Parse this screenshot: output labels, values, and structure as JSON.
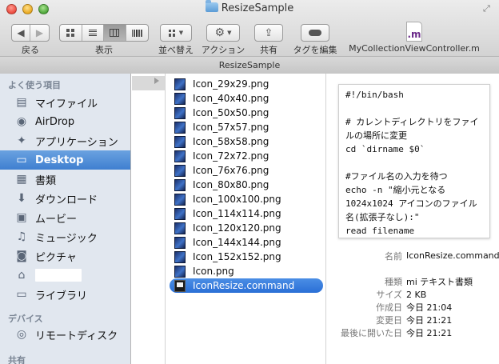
{
  "window": {
    "title": "ResizeSample"
  },
  "toolbar": {
    "back_label": "戻る",
    "view_label": "表示",
    "arrange_label": "並べ替え",
    "action_label": "アクション",
    "share_label": "共有",
    "tag_label": "タグを編集",
    "doc_label": "MyCollectionViewController.m",
    "doc_icon_text": ".m"
  },
  "path_bar": {
    "title": "ResizeSample"
  },
  "sidebar": {
    "favorites_header": "よく使う項目",
    "devices_header": "デバイス",
    "shared_header": "共有",
    "items": [
      {
        "label": "マイファイル",
        "icon": "all-my-files-icon"
      },
      {
        "label": "AirDrop",
        "icon": "airdrop-icon"
      },
      {
        "label": "アプリケーション",
        "icon": "applications-icon"
      },
      {
        "label": "Desktop",
        "icon": "desktop-icon",
        "selected": true
      },
      {
        "label": "書類",
        "icon": "documents-icon"
      },
      {
        "label": "ダウンロード",
        "icon": "downloads-icon"
      },
      {
        "label": "ムービー",
        "icon": "movies-icon"
      },
      {
        "label": "ミュージック",
        "icon": "music-icon"
      },
      {
        "label": "ピクチャ",
        "icon": "pictures-icon"
      },
      {
        "label": "",
        "icon": "home-icon"
      },
      {
        "label": "ライブラリ",
        "icon": "library-folder-icon"
      }
    ],
    "devices": [
      {
        "label": "リモートディスク",
        "icon": "remote-disc-icon"
      }
    ]
  },
  "files": [
    "Icon_29x29.png",
    "Icon_40x40.png",
    "Icon_50x50.png",
    "Icon_57x57.png",
    "Icon_58x58.png",
    "Icon_72x72.png",
    "Icon_76x76.png",
    "Icon_80x80.png",
    "Icon_100x100.png",
    "Icon_114x114.png",
    "Icon_120x120.png",
    "Icon_144x144.png",
    "Icon_152x152.png",
    "Icon.png",
    "IconResize.command"
  ],
  "selected_file": "IconResize.command",
  "preview": {
    "code": "#!/bin/bash\n\n# カレントディレクトリをファイルの場所に変更\ncd `dirname $0`\n\n#ファイル名の入力を待つ\necho -n \"縮小元となる1024x1024 アイコンのファイル名(拡張子なし):\"\nread filename\n\n#アイコンサイズ一覧(px)",
    "meta": {
      "name_key": "名前",
      "name_value": "IconResize.command",
      "kind_key": "種類",
      "kind_value": "mi テキスト書類",
      "size_key": "サイズ",
      "size_value": "2 KB",
      "created_key": "作成日",
      "created_value": "今日 21:04",
      "modified_key": "変更日",
      "modified_value": "今日 21:21",
      "opened_key": "最後に開いた日",
      "opened_value": "今日 21:21"
    }
  }
}
